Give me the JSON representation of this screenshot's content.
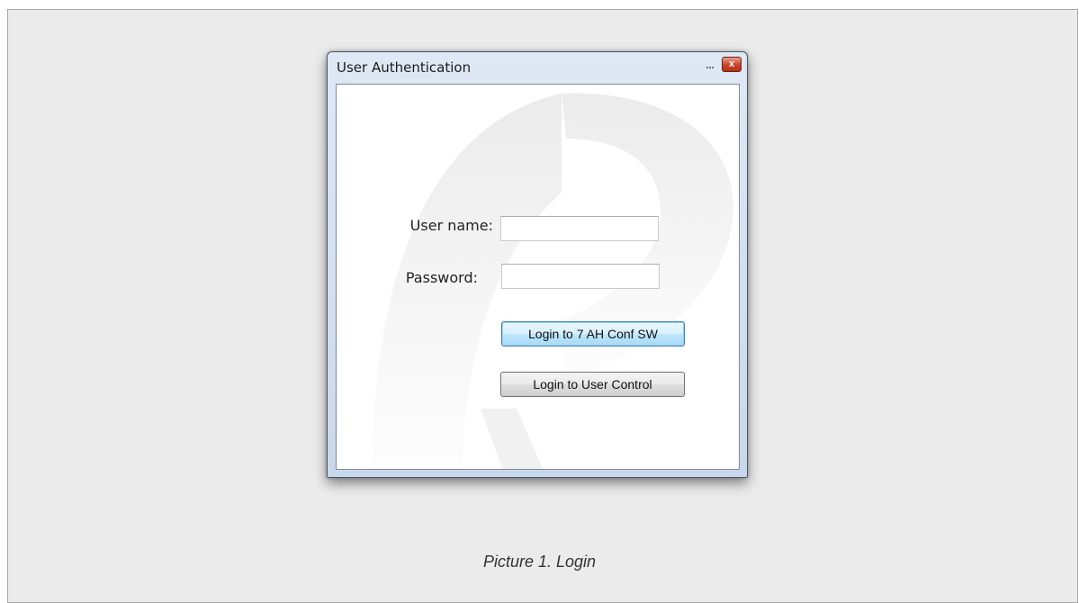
{
  "window": {
    "title": "User Authentication",
    "minimize_glyph": "...",
    "close_glyph": "x"
  },
  "form": {
    "username_label": "User name:",
    "username_value": "",
    "password_label": "Password:",
    "password_value": ""
  },
  "buttons": {
    "login_conf": "Login to 7 AH Conf SW",
    "login_user_control": "Login to User Control"
  },
  "caption": "Picture 1. Login",
  "icons": {
    "close": "close-icon",
    "minimize": "minimize-icon",
    "watermark": "logo-watermark"
  },
  "colors": {
    "accent_focus": "#3c7fb1",
    "close_button": "#c8442a",
    "background": "#ebebeb"
  }
}
